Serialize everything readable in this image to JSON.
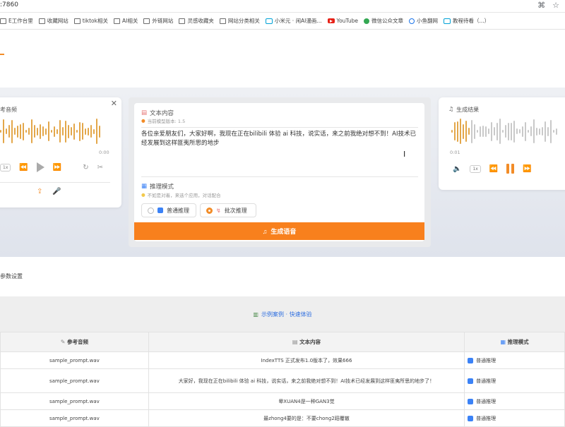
{
  "browser": {
    "url_fragment": ":7860",
    "bookmarks": [
      {
        "label": "E工作台里",
        "icon": "folder-icon"
      },
      {
        "label": "收藏网站",
        "icon": "folder-icon"
      },
      {
        "label": "tiktok相关",
        "icon": "folder-icon"
      },
      {
        "label": "AI相关",
        "icon": "folder-icon"
      },
      {
        "label": "外链网站",
        "icon": "folder-icon"
      },
      {
        "label": "灵感收藏夹",
        "icon": "folder-icon"
      },
      {
        "label": "网站分类相关",
        "icon": "folder-icon"
      },
      {
        "label": "小米元 · 闲AI漫画...",
        "icon": "bilibili-icon"
      },
      {
        "label": "YouTube",
        "icon": "youtube-icon"
      },
      {
        "label": "微信公众文章",
        "icon": "green-icon"
      },
      {
        "label": "小鱼翻网",
        "icon": "globe-icon"
      },
      {
        "label": "教程待看（...）",
        "icon": "bilibili-icon"
      }
    ]
  },
  "ref_audio": {
    "title": "考音频",
    "time_end": "0:00",
    "speed": "1x"
  },
  "text_panel": {
    "title": "文本内容",
    "subtitle": "当前模型版本: 1.5",
    "content": "各位亲爱朋友们，大家好啊，我现在正在bilibili 体验 ai 科技，说实话，来之前我绝对想不到！AI技术已经发展到这样匪夷所思的地步",
    "mode_title": "推理模式",
    "mode_subtitle": "不如是对着，来选个应用，对话配合",
    "options": [
      {
        "label": "普通推理",
        "selected": false
      },
      {
        "label": "批次推理",
        "selected": true
      }
    ],
    "generate_label": "生成语音"
  },
  "gen_audio": {
    "title": "生成结果",
    "time_start": "0:01",
    "speed": "1x"
  },
  "params_label": "参数设置",
  "examples": {
    "title": "示例案例 · 快速体验",
    "headers": {
      "ref": "参考音频",
      "text": "文本内容",
      "mode": "推理模式"
    },
    "rows": [
      {
        "ref": "sample_prompt.wav",
        "text": "IndexTTS 正式发布1.0版本了，效果666",
        "mode": "普通推理"
      },
      {
        "ref": "sample_prompt.wav",
        "text": "大家好，我现在正在bilibili 体验 ai 科技，说实话，来之前我绝对想不到！AI技术已经发展到这样匪夷所思的地步了！",
        "mode": "普通推理"
      },
      {
        "ref": "sample_prompt.wav",
        "text": "晕XUAN4是一种GAN3觉",
        "mode": "普通推理"
      },
      {
        "ref": "sample_prompt.wav",
        "text": "最zhong4要的是：不要chong2蹈覆辙",
        "mode": "普通推理"
      }
    ]
  },
  "colors": {
    "accent": "#f8801d",
    "wave_played": "#e3a74a",
    "wave_unplayed": "#c9c9c9",
    "link_blue": "#2f6fe0"
  }
}
